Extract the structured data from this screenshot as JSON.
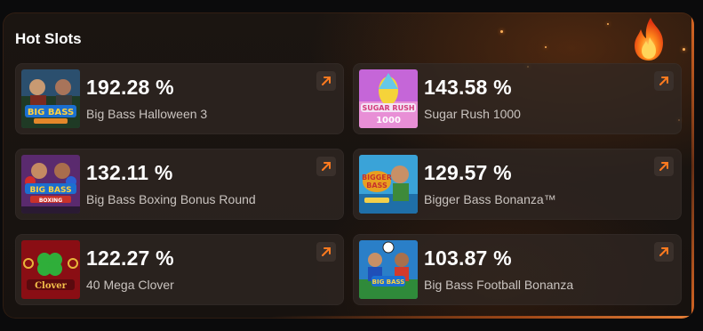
{
  "header": {
    "title": "Hot Slots",
    "icon": "flame-icon"
  },
  "colors": {
    "accent": "#ff7a1f",
    "percent_text": "#ffffff",
    "name_text": "#c9c3bf",
    "card_bg": "#302824"
  },
  "slots": [
    {
      "percent": "192.28 %",
      "name": "Big Bass Halloween 3",
      "thumb_icon": "big-bass-halloween-thumbnail",
      "link_icon": "arrow-up-right-icon"
    },
    {
      "percent": "143.58 %",
      "name": "Sugar Rush 1000",
      "thumb_icon": "sugar-rush-thumbnail",
      "link_icon": "arrow-up-right-icon"
    },
    {
      "percent": "132.11 %",
      "name": "Big Bass Boxing Bonus Round",
      "thumb_icon": "big-bass-boxing-thumbnail",
      "link_icon": "arrow-up-right-icon"
    },
    {
      "percent": "129.57 %",
      "name": "Bigger Bass Bonanza™",
      "thumb_icon": "bigger-bass-bonanza-thumbnail",
      "link_icon": "arrow-up-right-icon"
    },
    {
      "percent": "122.27 %",
      "name": "40 Mega Clover",
      "thumb_icon": "mega-clover-thumbnail",
      "link_icon": "arrow-up-right-icon"
    },
    {
      "percent": "103.87 %",
      "name": "Big Bass Football Bonanza",
      "thumb_icon": "big-bass-football-thumbnail",
      "link_icon": "arrow-up-right-icon"
    }
  ]
}
